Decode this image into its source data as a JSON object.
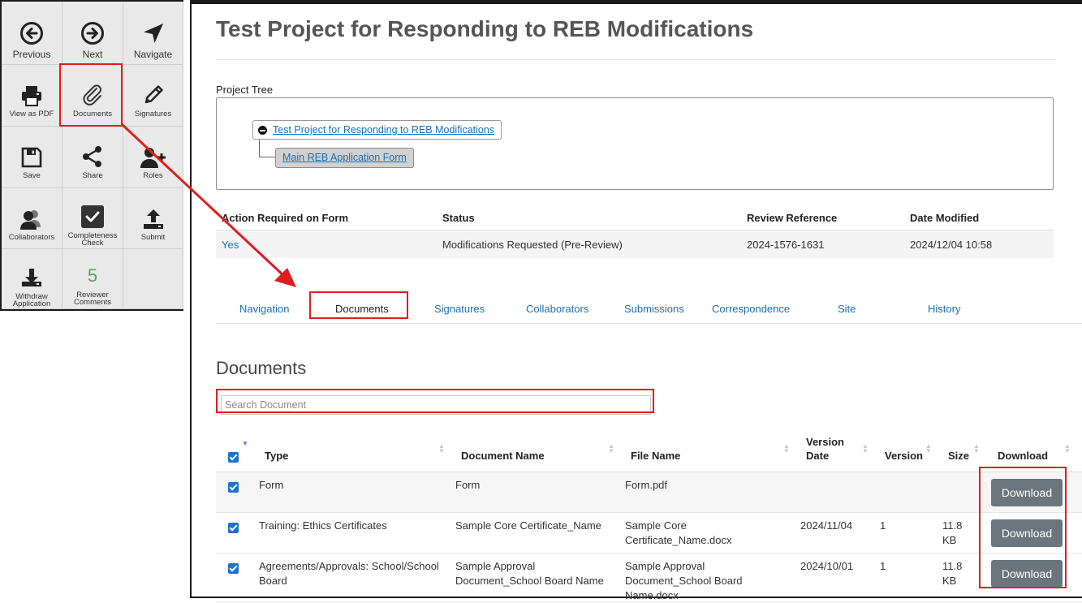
{
  "toolbar": {
    "previous": "Previous",
    "next": "Next",
    "navigate": "Navigate",
    "view_pdf": "View as PDF",
    "documents": "Documents",
    "signatures": "Signatures",
    "save": "Save",
    "share": "Share",
    "roles": "Roles",
    "collaborators": "Collaborators",
    "completeness": "Completeness Check",
    "submit": "Submit",
    "withdraw": "Withdraw Application",
    "reviewer_count": "5",
    "reviewer_comments": "Reviewer Comments"
  },
  "page": {
    "title": "Test Project for Responding to REB Modifications",
    "project_tree_label": "Project Tree",
    "tree_root": "Test Project for Responding to REB Modifications",
    "tree_child": "Main REB Application Form"
  },
  "status_table": {
    "headers": [
      "Action Required on Form",
      "Status",
      "Review Reference",
      "Date Modified"
    ],
    "row": {
      "action": "Yes",
      "status": "Modifications Requested (Pre-Review)",
      "reference": "2024-1576-1631",
      "date": "2024/12/04 10:58"
    }
  },
  "tabs": [
    "Navigation",
    "Documents",
    "Signatures",
    "Collaborators",
    "Submissions",
    "Correspondence",
    "Site",
    "History"
  ],
  "documents": {
    "heading": "Documents",
    "search_placeholder": "Search Document",
    "headers": {
      "type": "Type",
      "doc_name": "Document Name",
      "file_name": "File Name",
      "version_date_1": "Version",
      "version_date_2": "Date",
      "version": "Version",
      "size": "Size",
      "download": "Download"
    },
    "rows": [
      {
        "type": "Form",
        "doc_name": "Form",
        "file_name": "Form.pdf",
        "version_date": "",
        "version": "",
        "size": "",
        "button": "Download"
      },
      {
        "type": "Training: Ethics Certificates",
        "doc_name": "Sample Core Certificate_Name",
        "file_name": "Sample Core Certificate_Name.docx",
        "version_date": "2024/11/04",
        "version": "1",
        "size": "11.8 KB",
        "button": "Download"
      },
      {
        "type": "Agreements/Approvals: School/School Board",
        "doc_name": "Sample Approval Document_School Board Name",
        "file_name": "Sample Approval Document_School Board Name.docx",
        "version_date": "2024/10/01",
        "version": "1",
        "size": "11.8 KB",
        "button": "Download"
      }
    ]
  },
  "colors": {
    "link": "#1a6fb5",
    "highlight": "#e01e1e",
    "download_button": "#6c757d",
    "checkbox": "#1a73d1",
    "count": "#5aa35a"
  }
}
